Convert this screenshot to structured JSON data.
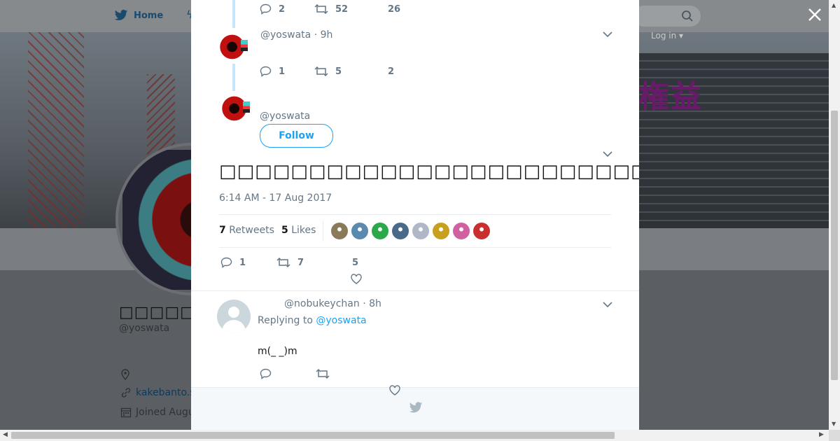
{
  "nav": {
    "home_label": "Home",
    "login_label": "Log in"
  },
  "banner": {
    "text": "権益"
  },
  "profile": {
    "name": "□□□□□□",
    "handle": "@yoswata",
    "link_text": "kakebanto.s",
    "joined_text": "Joined Augu"
  },
  "thread": {
    "tweet1": {
      "replies": "2",
      "retweets": "52",
      "likes": "26"
    },
    "tweet2": {
      "handle": "@yoswata",
      "time": "· 9h",
      "replies": "1",
      "retweets": "5",
      "likes": "2"
    }
  },
  "main_tweet": {
    "handle": "@yoswata",
    "follow_label": "Follow",
    "text": "□□□□□□□□□□□□□□□□□□□□□□□□□□□□□□□□□□□□□□□□□□□□□□□□□□□□□□",
    "timestamp": "6:14 AM - 17 Aug 2017",
    "retweets_count": "7",
    "retweets_label": "Retweets",
    "likes_count": "5",
    "likes_label": "Likes",
    "action_replies": "1",
    "action_retweets": "7",
    "action_likes": "5",
    "liker_colors": [
      "#8a7a5a",
      "#5a8ab0",
      "#2aa84a",
      "#4a6a8a",
      "#b0b8c8",
      "#c8a020",
      "#d060a0",
      "#c83030"
    ]
  },
  "reply": {
    "handle": "@nobukeychan",
    "time": "· 8h",
    "replying_prefix": "Replying to",
    "replying_to": "@yoswata",
    "text": "m(_ _)m"
  },
  "colors": {
    "accent": "#1da1f2",
    "thread_line": "#c4e6fa",
    "muted": "#657786"
  }
}
